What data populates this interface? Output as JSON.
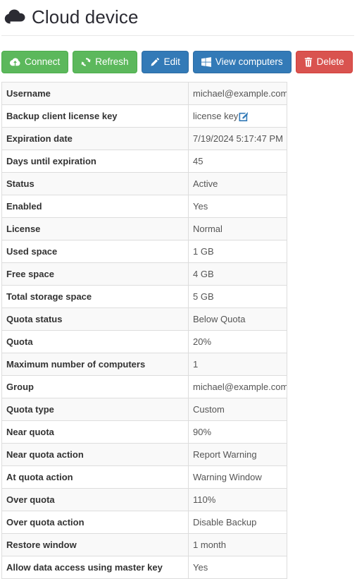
{
  "header": {
    "title": "Cloud device",
    "icon": "cloud-icon"
  },
  "toolbar": {
    "buttons": [
      {
        "label": "Connect",
        "icon": "cloud-download-icon",
        "style": "success"
      },
      {
        "label": "Refresh",
        "icon": "refresh-icon",
        "style": "success"
      },
      {
        "label": "Edit",
        "icon": "pencil-icon",
        "style": "primary"
      },
      {
        "label": "View computers",
        "icon": "windows-icon",
        "style": "primary"
      },
      {
        "label": "Delete",
        "icon": "trash-icon",
        "style": "danger"
      }
    ]
  },
  "colors": {
    "success": "#5cb85c",
    "primary": "#337ab7",
    "danger": "#d9534f",
    "link": "#337ab7",
    "border": "#dddddd",
    "stripe": "#f9f9f9"
  },
  "details": {
    "rows": [
      {
        "label": "Username",
        "value": "michael@example.com"
      },
      {
        "label": "Backup client license key",
        "value": "license key",
        "edit_icon": "edit-square-icon"
      },
      {
        "label": "Expiration date",
        "value": "7/19/2024 5:17:47 PM"
      },
      {
        "label": "Days until expiration",
        "value": "45"
      },
      {
        "label": "Status",
        "value": "Active"
      },
      {
        "label": "Enabled",
        "value": "Yes"
      },
      {
        "label": "License",
        "value": "Normal"
      },
      {
        "label": "Used space",
        "value": "1 GB"
      },
      {
        "label": "Free space",
        "value": "4 GB"
      },
      {
        "label": "Total storage space",
        "value": "5 GB"
      },
      {
        "label": "Quota status",
        "value": "Below Quota"
      },
      {
        "label": "Quota",
        "value": "20%"
      },
      {
        "label": "Maximum number of computers",
        "value": "1"
      },
      {
        "label": "Group",
        "value": "michael@example.com"
      },
      {
        "label": "Quota type",
        "value": "Custom"
      },
      {
        "label": "Near quota",
        "value": "90%"
      },
      {
        "label": "Near quota action",
        "value": "Report Warning"
      },
      {
        "label": "At quota action",
        "value": "Warning Window"
      },
      {
        "label": "Over quota",
        "value": "110%"
      },
      {
        "label": "Over quota action",
        "value": "Disable Backup"
      },
      {
        "label": "Restore window",
        "value": "1 month"
      },
      {
        "label": "Allow data access using master key",
        "value": "Yes"
      }
    ]
  }
}
